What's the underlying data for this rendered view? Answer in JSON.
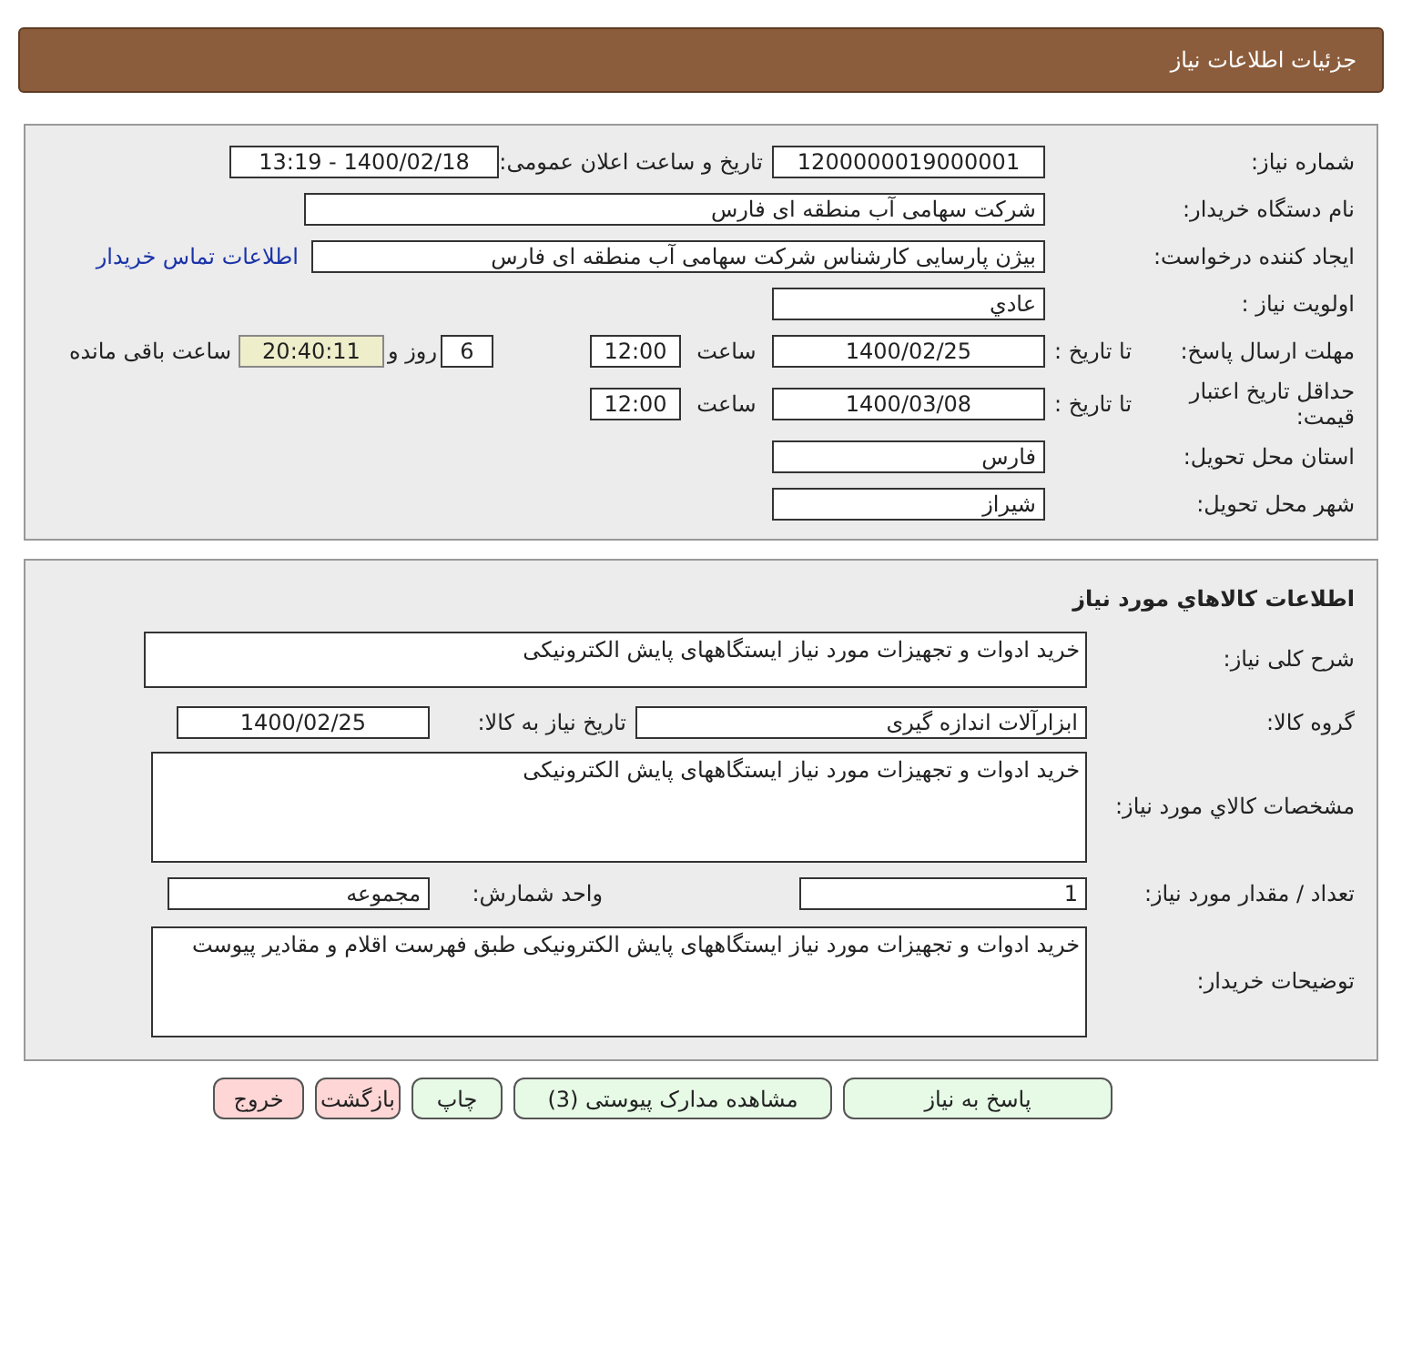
{
  "header": {
    "title": "جزئیات اطلاعات نیاز"
  },
  "request": {
    "need_number": {
      "label": "شماره نیاز:",
      "value": "1200000019000001"
    },
    "announce": {
      "label": "تاریخ و ساعت اعلان عمومی:",
      "value": "1400/02/18 - 13:19"
    },
    "buyer": {
      "label": "نام دستگاه خریدار:",
      "value": "شرکت سهامی آب منطقه ای فارس"
    },
    "creator": {
      "label": "ایجاد کننده درخواست:",
      "value": "بیژن پارسایی کارشناس شرکت سهامی آب منطقه ای فارس"
    },
    "contact_link": "اطلاعات تماس خریدار",
    "priority": {
      "label": "اولویت نیاز :",
      "value": "عادي"
    },
    "deadline": {
      "label": "مهلت ارسال پاسخ:",
      "to_date_label": "تا تاریخ :",
      "date": "1400/02/25",
      "time_label": "ساعت",
      "time": "12:00",
      "days": "6",
      "days_label": "روز و",
      "remaining": "20:40:11",
      "remaining_label": "ساعت باقی مانده"
    },
    "validity": {
      "label": "حداقل تاریخ اعتبار قیمت:",
      "to_date_label": "تا تاریخ :",
      "date": "1400/03/08",
      "time_label": "ساعت",
      "time": "12:00"
    },
    "province": {
      "label": "استان محل تحویل:",
      "value": "فارس"
    },
    "city": {
      "label": "شهر محل تحویل:",
      "value": "شیراز"
    }
  },
  "goods": {
    "title": "اطلاعات كالاهاي مورد نیاز",
    "summary": {
      "label": "شرح کلی نیاز:",
      "value": "خرید ادوات و تجهیزات مورد نیاز ایستگاههای پایش الکترونیکی"
    },
    "group": {
      "label": "گروه کالا:",
      "value": "ابزارآلات اندازه گیری"
    },
    "need_date": {
      "label": "تاریخ نیاز به کالا:",
      "value": "1400/02/25"
    },
    "specs": {
      "label": "مشخصات كالاي مورد نیاز:",
      "value": "خرید ادوات و تجهیزات مورد نیاز ایستگاههای پایش الکترونیکی"
    },
    "quantity": {
      "label": "تعداد / مقدار مورد نیاز:",
      "value": "1"
    },
    "unit": {
      "label": "واحد شمارش:",
      "value": "مجموعه"
    },
    "notes": {
      "label": "توضیحات خریدار:",
      "value": "خرید ادوات و تجهیزات مورد نیاز ایستگاههای پایش الکترونیکی طبق فهرست اقلام و مقادیر پیوست"
    }
  },
  "buttons": [
    {
      "label": "پاسخ به نیاز",
      "color": "#e6fae6"
    },
    {
      "label": "مشاهده مدارک پیوستی (3)",
      "color": "#e6fae6"
    },
    {
      "label": "چاپ",
      "color": "#e6fae6"
    },
    {
      "label": "بازگشت",
      "color": "#ffd6d6"
    },
    {
      "label": "خروج",
      "color": "#ffd6d6"
    }
  ]
}
